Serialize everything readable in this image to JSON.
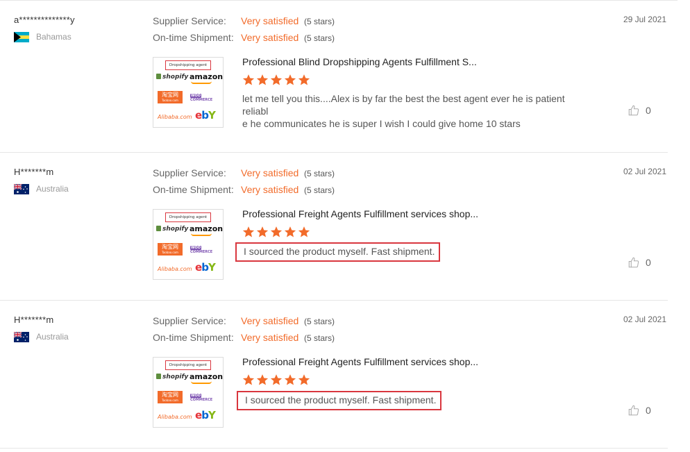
{
  "labels": {
    "supplier_service": "Supplier Service:",
    "shipment": "On-time Shipment:"
  },
  "colors": {
    "accent": "#f26b2a",
    "highlight": "#d9363e"
  },
  "thumbnail": {
    "agent": "Dropshipping agent",
    "shopify": "shopify",
    "amazon": "amazon",
    "taobao": "淘宝网",
    "taobao_sub": "Taobao.com",
    "woo": "WOO",
    "woo_sub": "COMMERCE",
    "alibaba": "Alibaba.com",
    "ebay_e": "e",
    "ebay_b": "b",
    "ebay_a": "a",
    "ebay_y": "Y"
  },
  "reviews": [
    {
      "buyer": "a**************y",
      "country": "Bahamas",
      "flag": "bahamas-flag",
      "supplier_rating": "Very satisfied",
      "supplier_stars": "(5 stars)",
      "shipment_rating": "Very satisfied",
      "shipment_stars": "(5 stars)",
      "date": "29 Jul 2021",
      "product": "Professional Blind Dropshipping Agents Fulfillment S...",
      "stars": 5,
      "comment_line1": "let me tell you this....Alex  is by far the best the best agent ever he is patient reliabl",
      "comment_line2": "e he communicates he is super I wish I could give home 10 stars",
      "likes": "0"
    },
    {
      "buyer": "H*******m",
      "country": "Australia",
      "flag": "australia-flag",
      "supplier_rating": "Very satisfied",
      "supplier_stars": "(5 stars)",
      "shipment_rating": "Very satisfied",
      "shipment_stars": "(5 stars)",
      "date": "02 Jul 2021",
      "product": "Professional Freight Agents Fulfillment services shop...",
      "stars": 5,
      "comment": "I sourced the product myself. Fast shipment.",
      "likes": "0"
    },
    {
      "buyer": "H*******m",
      "country": "Australia",
      "flag": "australia-flag",
      "supplier_rating": "Very satisfied",
      "supplier_stars": "(5 stars)",
      "shipment_rating": "Very satisfied",
      "shipment_stars": "(5 stars)",
      "date": "02 Jul 2021",
      "product": "Professional Freight Agents Fulfillment services shop...",
      "stars": 5,
      "comment": "I sourced the product myself. Fast shipment.",
      "likes": "0"
    }
  ]
}
